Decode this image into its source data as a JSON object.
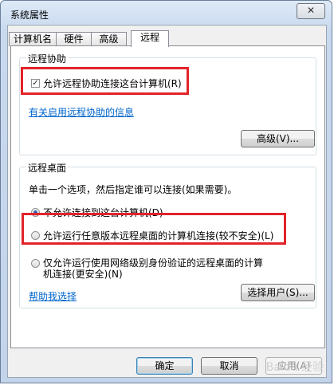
{
  "window": {
    "title": "系统属性",
    "close_glyph": "✕"
  },
  "tabs": [
    {
      "label": "计算机名"
    },
    {
      "label": "硬件"
    },
    {
      "label": "高级"
    },
    {
      "label": "远程",
      "active": true
    }
  ],
  "remote_assistance": {
    "group_label": "远程协助",
    "allow_checkbox_label": "允许远程协助连接这台计算机(R)",
    "allow_checked": true,
    "info_link": "有关启用远程协助的信息",
    "advanced_button": "高级(V)..."
  },
  "remote_desktop": {
    "group_label": "远程桌面",
    "instruction": "单击一个选项，然后指定谁可以连接(如果需要)。",
    "options": [
      {
        "label": "不允许连接到这台计算机(D)",
        "selected": true
      },
      {
        "label": "允许运行任意版本远程桌面的计算机连接(较不安全)(L)",
        "selected": false
      },
      {
        "label_line1": "仅允许运行使用网络级别身份验证的远程桌面的计算",
        "label_line2": "机连接(更安全)(N)",
        "selected": false
      }
    ],
    "help_link": "帮助我选择",
    "select_users_button": "选择用户(S)..."
  },
  "footer": {
    "ok": "确定",
    "cancel": "取消",
    "apply": "应用(A)"
  },
  "watermark": "Baidu 经验",
  "colors": {
    "highlight_box": "#e2232a",
    "link": "#0066cc"
  }
}
